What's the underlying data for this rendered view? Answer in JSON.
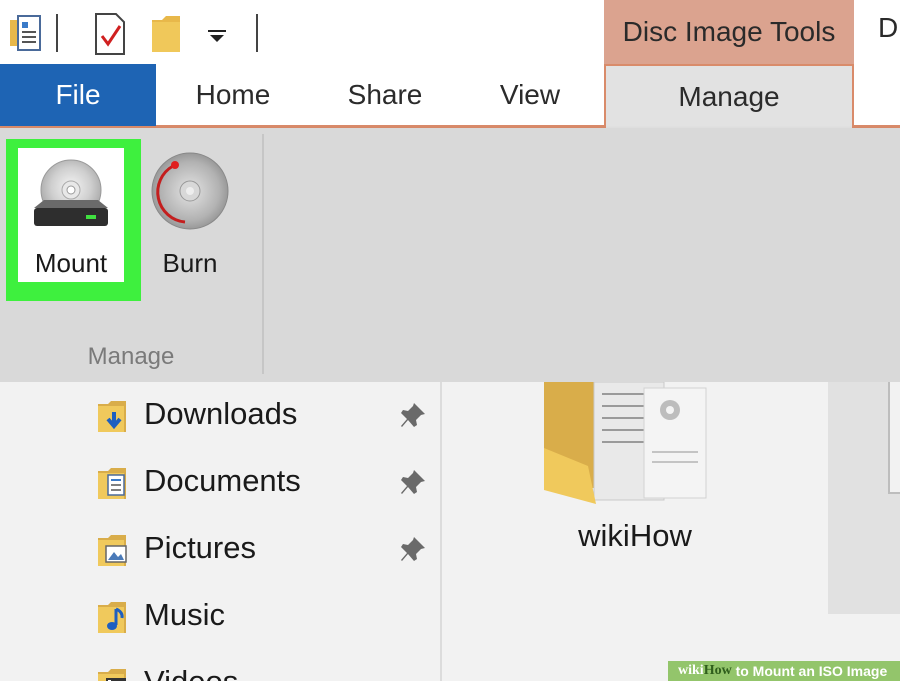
{
  "quick_access": {
    "icons": [
      "properties-icon",
      "checklist-icon",
      "folder-icon",
      "dropdown-arrow-icon"
    ]
  },
  "context_header": {
    "label": "Disc Image Tools",
    "title_fragment": "D"
  },
  "tabs": [
    {
      "label": "File",
      "active": false
    },
    {
      "label": "Home",
      "active": false
    },
    {
      "label": "Share",
      "active": false
    },
    {
      "label": "View",
      "active": false
    },
    {
      "label": "Manage",
      "active": true
    }
  ],
  "ribbon": {
    "buttons": [
      {
        "label": "Mount",
        "icon": "disc-drive-icon",
        "highlighted": true
      },
      {
        "label": "Burn",
        "icon": "burn-disc-icon",
        "highlighted": false
      }
    ],
    "group_label": "Manage"
  },
  "navigation": {
    "items": [
      {
        "label": "Downloads",
        "icon": "downloads-folder-icon",
        "pinned": true
      },
      {
        "label": "Documents",
        "icon": "documents-folder-icon",
        "pinned": true
      },
      {
        "label": "Pictures",
        "icon": "pictures-folder-icon",
        "pinned": true
      },
      {
        "label": "Music",
        "icon": "music-folder-icon",
        "pinned": false
      },
      {
        "label": "Videos",
        "icon": "videos-folder-icon",
        "pinned": false
      }
    ]
  },
  "content": {
    "items": [
      {
        "label": "wikiHow",
        "icon": "folder-icon"
      }
    ]
  },
  "watermark": {
    "logo_a": "wiki",
    "logo_b": "How",
    "text": " to Mount an ISO Image"
  },
  "colors": {
    "file_tab": "#1e64b4",
    "context_header": "#dba38f",
    "highlight": "#3ef03e",
    "ribbon_bg": "#d9d9d9"
  }
}
